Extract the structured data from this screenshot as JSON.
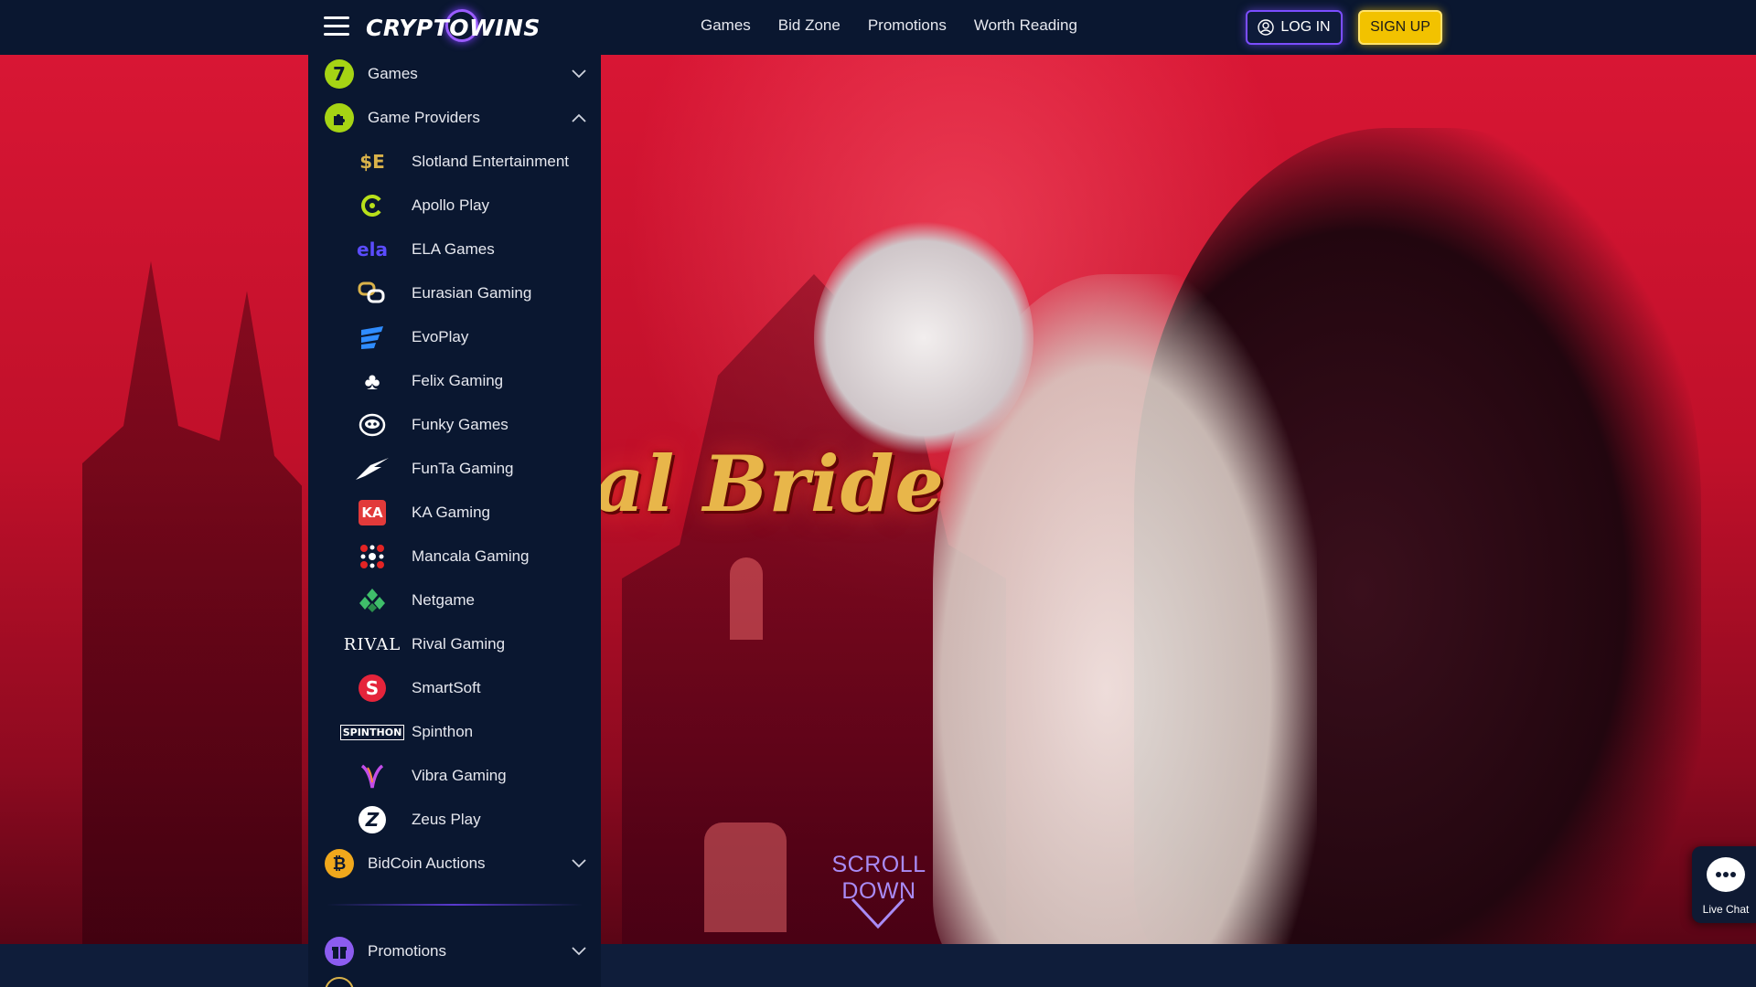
{
  "brand": {
    "logo_text": "CRYPTOWINS"
  },
  "nav": {
    "links": [
      "Games",
      "Bid Zone",
      "Promotions",
      "Worth Reading"
    ],
    "login_label": "LOG IN",
    "signup_label": "SIGN UP"
  },
  "side_menu": {
    "games": {
      "label": "Games",
      "icon": "seven-icon"
    },
    "providers": {
      "label": "Game Providers",
      "icon": "puzzle-icon",
      "expanded": true
    },
    "provider_items": [
      {
        "label": "Slotland Entertainment",
        "icon": "slotland-logo-icon"
      },
      {
        "label": "Apollo Play",
        "icon": "apollo-logo-icon"
      },
      {
        "label": "ELA Games",
        "icon": "ela-logo-icon"
      },
      {
        "label": "Eurasian Gaming",
        "icon": "eurasian-logo-icon"
      },
      {
        "label": "EvoPlay",
        "icon": "evoplay-logo-icon"
      },
      {
        "label": "Felix Gaming",
        "icon": "felix-logo-icon"
      },
      {
        "label": "Funky Games",
        "icon": "funky-logo-icon"
      },
      {
        "label": "FunTa Gaming",
        "icon": "funta-logo-icon"
      },
      {
        "label": "KA Gaming",
        "icon": "ka-logo-icon"
      },
      {
        "label": "Mancala Gaming",
        "icon": "mancala-logo-icon"
      },
      {
        "label": "Netgame",
        "icon": "netgame-logo-icon"
      },
      {
        "label": "Rival Gaming",
        "icon": "rival-logo-icon"
      },
      {
        "label": "SmartSoft",
        "icon": "smartsoft-logo-icon"
      },
      {
        "label": "Spinthon",
        "icon": "spinthon-logo-icon"
      },
      {
        "label": "Vibra Gaming",
        "icon": "vibra-logo-icon"
      },
      {
        "label": "Zeus Play",
        "icon": "zeus-logo-icon"
      }
    ],
    "bidcoin": {
      "label": "BidCoin Auctions",
      "icon": "bitcoin-icon"
    },
    "promotions": {
      "label": "Promotions",
      "icon": "gift-icon"
    }
  },
  "hero": {
    "title_fragment": "al Bride",
    "scroll_label": "SCROLL DOWN"
  },
  "live_chat": {
    "label": "Live Chat"
  },
  "colors": {
    "nav_bg": "#0a1730",
    "accent_purple": "#7b4dff",
    "signup_yellow": "#f2c200",
    "hero_red": "#c0102a",
    "icon_green": "#a6d414"
  }
}
